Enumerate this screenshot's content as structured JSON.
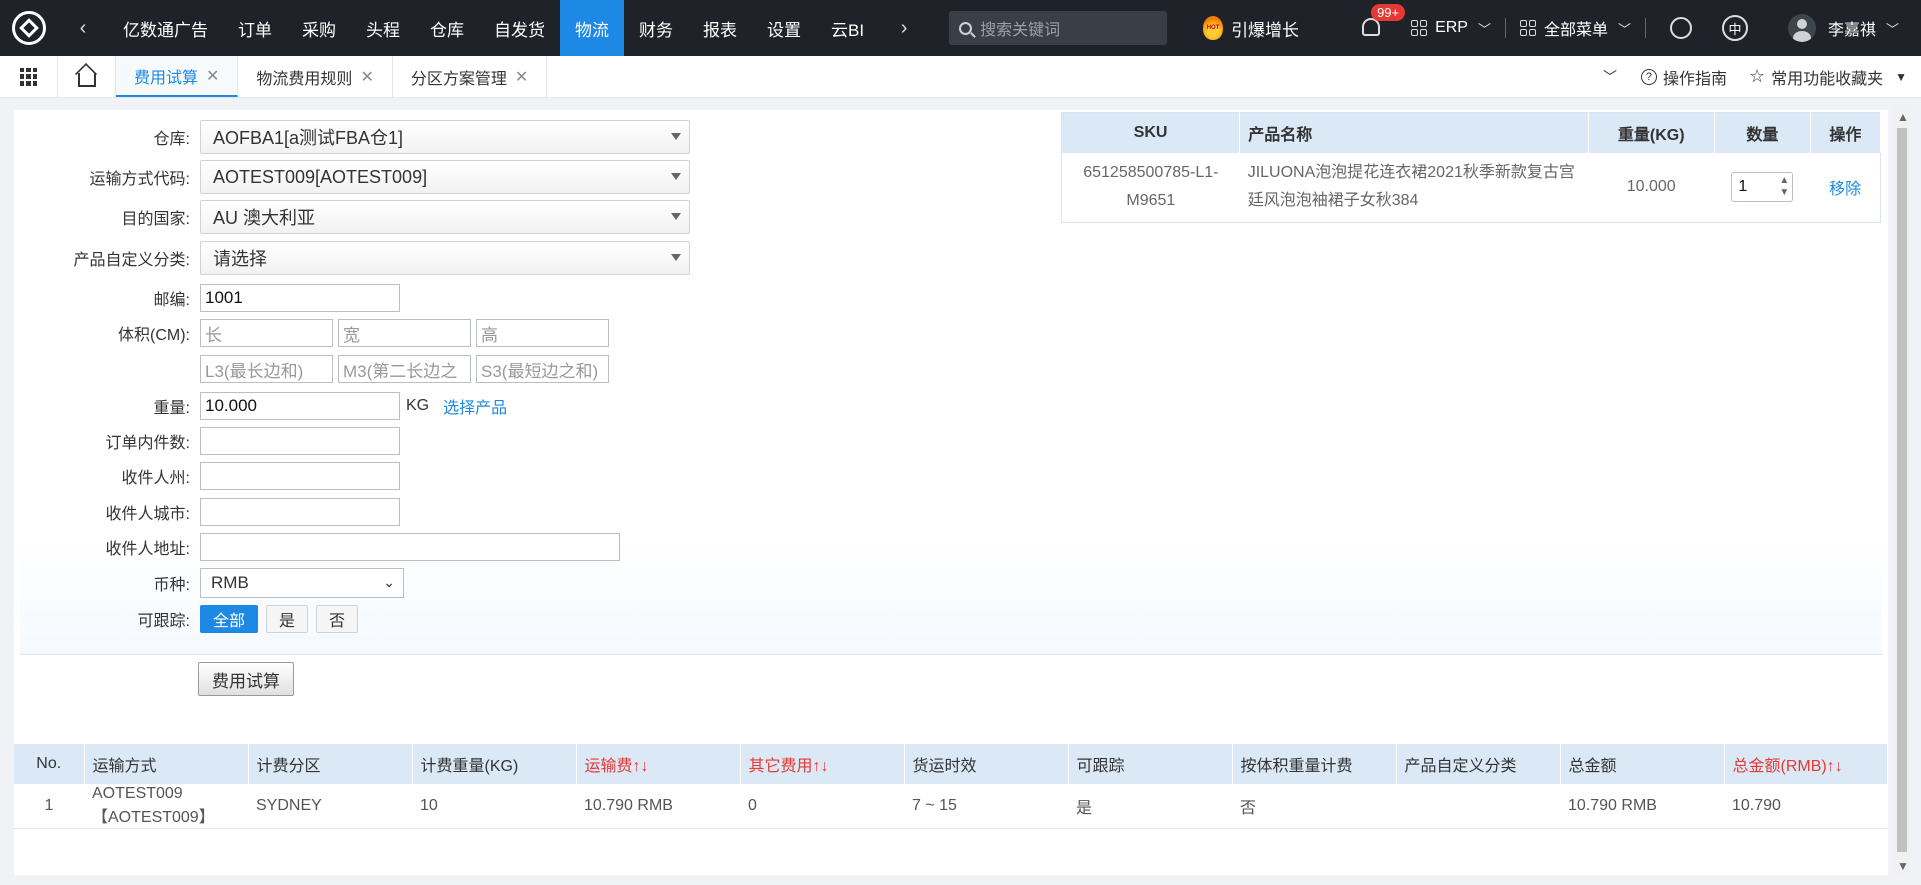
{
  "nav": {
    "menu": [
      "亿数通广告",
      "订单",
      "采购",
      "头程",
      "仓库",
      "自发货",
      "物流",
      "财务",
      "报表",
      "设置",
      "云BI"
    ],
    "active": "物流",
    "search_placeholder": "搜索关键词",
    "hot_label": "引爆增长",
    "hot_badge": "HOT",
    "notif_count": "99+",
    "erp_label": "ERP",
    "all_menu": "全部菜单",
    "lang": "中",
    "user_name": "李嘉祺"
  },
  "tabs": {
    "items": [
      {
        "label": "费用试算",
        "active": true
      },
      {
        "label": "物流费用规则",
        "active": false
      },
      {
        "label": "分区方案管理",
        "active": false
      }
    ],
    "guide": "操作指南",
    "favorites": "常用功能收藏夹"
  },
  "form": {
    "warehouse_label": "仓库:",
    "warehouse_value": "AOFBA1[a测试FBA仓1]",
    "shipping_label": "运输方式代码:",
    "shipping_value": "AOTEST009[AOTEST009]",
    "country_label": "目的国家:",
    "country_value": "AU 澳大利亚",
    "category_label": "产品自定义分类:",
    "category_value": "请选择",
    "zip_label": "邮编:",
    "zip_value": "1001",
    "volume_label": "体积(CM):",
    "len_ph": "长",
    "wid_ph": "宽",
    "hei_ph": "高",
    "l3_ph": "L3(最长边和)",
    "m3_ph": "M3(第二长边之",
    "s3_ph": "S3(最短边之和)",
    "weight_label": "重量:",
    "weight_value": "10.000",
    "weight_unit": "KG",
    "select_product": "选择产品",
    "pieces_label": "订单内件数:",
    "state_label": "收件人州:",
    "city_label": "收件人城市:",
    "address_label": "收件人地址:",
    "currency_label": "币种:",
    "currency_value": "RMB",
    "track_label": "可跟踪:",
    "track_all": "全部",
    "track_yes": "是",
    "track_no": "否",
    "calc_button": "费用试算"
  },
  "sku_table": {
    "headers": [
      "SKU",
      "产品名称",
      "重量(KG)",
      "数量",
      "操作"
    ],
    "row": {
      "sku": "651258500785-L1-M9651",
      "name": "JILUONA泡泡提花连衣裙2021秋季新款复古宫廷风泡泡袖裙子女秋384",
      "weight": "10.000",
      "qty": "1",
      "action": "移除"
    }
  },
  "result_table": {
    "headers": [
      "No.",
      "运输方式",
      "计费分区",
      "计费重量(KG)",
      "运输费↑↓",
      "其它费用↑↓",
      "货运时效",
      "可跟踪",
      "按体积重量计费",
      "产品自定义分类",
      "总金额",
      "总金额(RMB)↑↓"
    ],
    "row": {
      "no": "1",
      "method": "AOTEST009 【AOTEST009】",
      "zone": "SYDNEY",
      "charge_weight": "10",
      "freight": "10.790 RMB",
      "other": "0",
      "time": "7 ~ 15",
      "trackable": "是",
      "by_volume": "否",
      "category": "",
      "total": "10.790 RMB",
      "total_rmb": "10.790"
    }
  }
}
